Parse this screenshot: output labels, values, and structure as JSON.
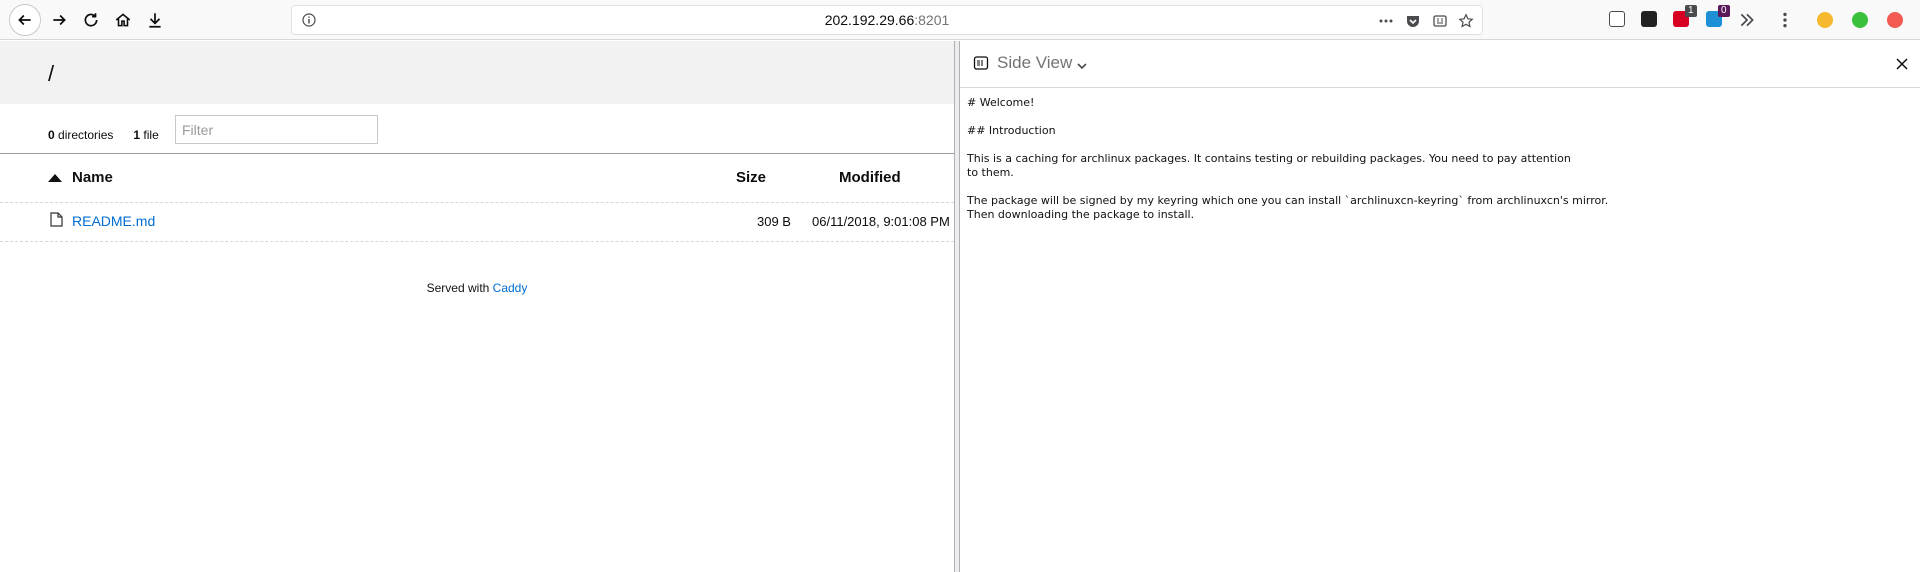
{
  "browser": {
    "url_host": "202.192.29.66",
    "url_port": ":8201",
    "extension_badges": [
      "1",
      "0"
    ]
  },
  "listing": {
    "path": "/",
    "dir_count": "0",
    "dir_label": "directories",
    "file_count": "1",
    "file_label": "file",
    "filter_placeholder": "Filter",
    "columns": {
      "name": "Name",
      "size": "Size",
      "modified": "Modified"
    },
    "files": [
      {
        "name": "README.md",
        "size": "309 B",
        "modified": "06/11/2018, 9:01:08 PM"
      }
    ],
    "footer_prefix": "Served with",
    "footer_link": "Caddy"
  },
  "side_view": {
    "title": "Side View",
    "lines": [
      "# Welcome!",
      "## Introduction",
      "This is a caching for archlinux packages. It contains testing or rebuilding packages. You need to pay attention\nto them.",
      "The package will be signed by my keyring which one you can install `archlinuxcn-keyring` from archlinuxcn's mirror.\nThen downloading the package to install."
    ]
  }
}
